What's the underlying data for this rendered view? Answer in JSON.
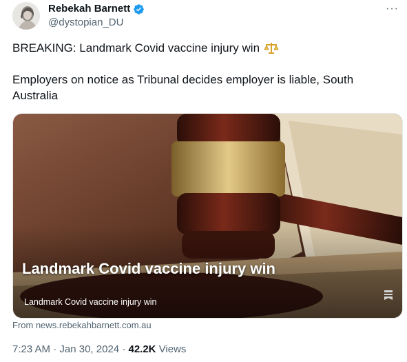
{
  "author": {
    "display_name": "Rebekah Barnett",
    "handle": "@dystopian_DU",
    "verified_color": "#1d9bf0"
  },
  "more_label": "···",
  "tweet": {
    "line1": "BREAKING: Landmark Covid vaccine injury win",
    "line2": "Employers on notice as Tribunal decides employer is liable, South Australia",
    "emoji": "balance-scale-icon"
  },
  "card": {
    "overlay_title": "Landmark Covid vaccine injury win",
    "caption": "Landmark Covid vaccine injury win",
    "source": "From news.rebekahbarnett.com.au"
  },
  "meta": {
    "time": "7:23 AM",
    "sep1": "·",
    "date": "Jan 30, 2024",
    "sep2": "·",
    "views_count": "42.2K",
    "views_label": "Views"
  }
}
